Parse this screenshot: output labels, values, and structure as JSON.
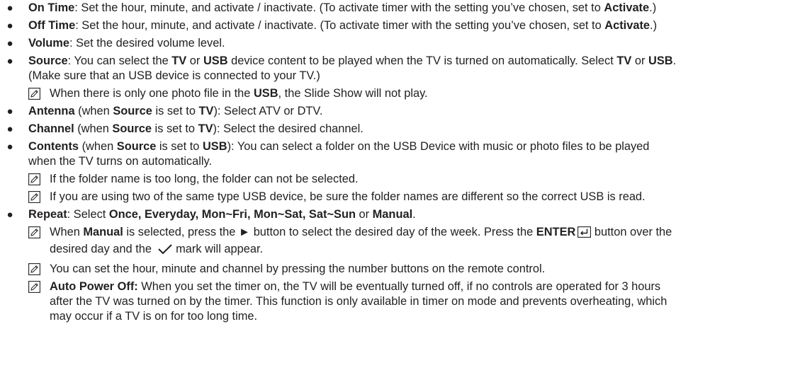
{
  "items": [
    {
      "id": "on-time",
      "term": "On Time",
      "text": ": Set the hour, minute, and activate / inactivate. (To activate timer with the setting you’ve chosen, set to ",
      "term2": "Activate",
      "tail": ".)"
    },
    {
      "id": "off-time",
      "term": "Off Time",
      "text": ": Set the hour, minute, and activate / inactivate. (To activate timer with the setting you’ve chosen, set to ",
      "term2": "Activate",
      "tail": ".)"
    },
    {
      "id": "volume",
      "term": "Volume",
      "text": ": Set the desired volume level."
    },
    {
      "id": "source",
      "term": "Source",
      "seg1": ": You can select the ",
      "b1": "TV",
      "seg2": " or ",
      "b2": "USB",
      "seg3": " device content to be played when the TV is turned on automatically. Select ",
      "b3": "TV",
      "seg4": " or ",
      "b4": "USB",
      "seg5": ".",
      "line2": "(Make sure that an USB device is connected to your TV.)",
      "note": {
        "pre": "When there is only one photo file in the ",
        "bold": "USB",
        "post": ", the Slide Show will not play."
      }
    },
    {
      "id": "antenna",
      "term": "Antenna",
      "seg1": " (when ",
      "b1": "Source",
      "seg2": " is set to ",
      "b2": "TV",
      "seg3": "): Select ATV or DTV."
    },
    {
      "id": "channel",
      "term": "Channel",
      "seg1": " (when ",
      "b1": "Source",
      "seg2": " is set to ",
      "b2": "TV",
      "seg3": "): Select the desired channel."
    },
    {
      "id": "contents",
      "term": "Contents",
      "seg1": " (when ",
      "b1": "Source",
      "seg2": " is set to ",
      "b2": "USB",
      "seg3": "): You can select a folder on the USB Device with music or photo files to be played",
      "line2": "when the TV turns on automatically.",
      "notes": [
        "If the folder name is too long, the folder can not be selected.",
        "If you are using two of the same type USB device, be sure the folder names are different so the correct USB is read."
      ]
    },
    {
      "id": "repeat",
      "term": "Repeat",
      "seg1": ": Select ",
      "b1": "Once, Everyday, Mon~Fri, Mon~Sat, Sat~Sun",
      "seg2": " or ",
      "b2": "Manual",
      "seg3": ".",
      "note1": {
        "pre": "When ",
        "bold": "Manual",
        "mid": " is selected, press the ► button to select the desired day of the week. Press the ",
        "bold2": "ENTER",
        "post": " button over the",
        "line2a": "desired day and the ",
        "line2b": " mark will appear."
      },
      "note2": "You can set the hour, minute and channel by pressing the number buttons on the remote control.",
      "note3": {
        "bold": "Auto Power Off:",
        "line1": " When you set the timer on, the TV will be eventually turned off, if no controls are operated for 3 hours",
        "line2": "after the TV was turned on by the timer. This function is only available in timer on mode and prevents overheating, which",
        "line3": "may occur if a TV is on for too long time."
      }
    }
  ],
  "bullet_glyph": "●",
  "icons": {
    "note": "note-pencil-icon",
    "enter": "enter-key-icon",
    "check": "checkmark-icon"
  }
}
